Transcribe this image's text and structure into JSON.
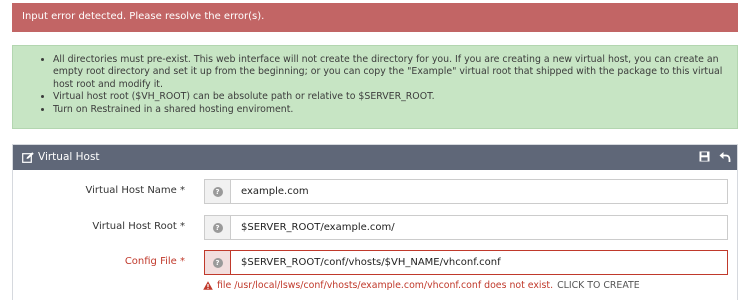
{
  "error_banner": {
    "text": "Input error detected. Please resolve the error(s)."
  },
  "info": {
    "items": [
      "All directories must pre-exist. This web interface will not create the directory for you. If you are creating a new virtual host, you can create an empty root directory and set it up from the beginning; or you can copy the \"Example\" virtual root that shipped with the package to this virtual host root and modify it.",
      "Virtual host root ($VH_ROOT) can be absolute path or relative to $SERVER_ROOT.",
      "Turn on Restrained in a shared hosting enviroment."
    ]
  },
  "panel": {
    "title": "Virtual Host",
    "icons": {
      "title": "edit-icon",
      "save": "save-icon",
      "back": "back-arrow-icon"
    }
  },
  "form": {
    "rows": [
      {
        "label": "Virtual Host Name *",
        "value": "example.com"
      },
      {
        "label": "Virtual Host Root *",
        "value": "$SERVER_ROOT/example.com/"
      },
      {
        "label": "Config File *",
        "value": "$SERVER_ROOT/conf/vhosts/$VH_NAME/vhconf.conf"
      }
    ],
    "help_glyph": "?",
    "config_error": {
      "message": "file /usr/local/lsws/conf/vhosts/example.com/vhconf.conf does not exist.",
      "action": "CLICK TO CREATE"
    }
  },
  "colors": {
    "error_banner": "#c26565",
    "info_bg": "#c7e5c4",
    "panel_header": "#5f6778",
    "error_text": "#c0392b"
  }
}
